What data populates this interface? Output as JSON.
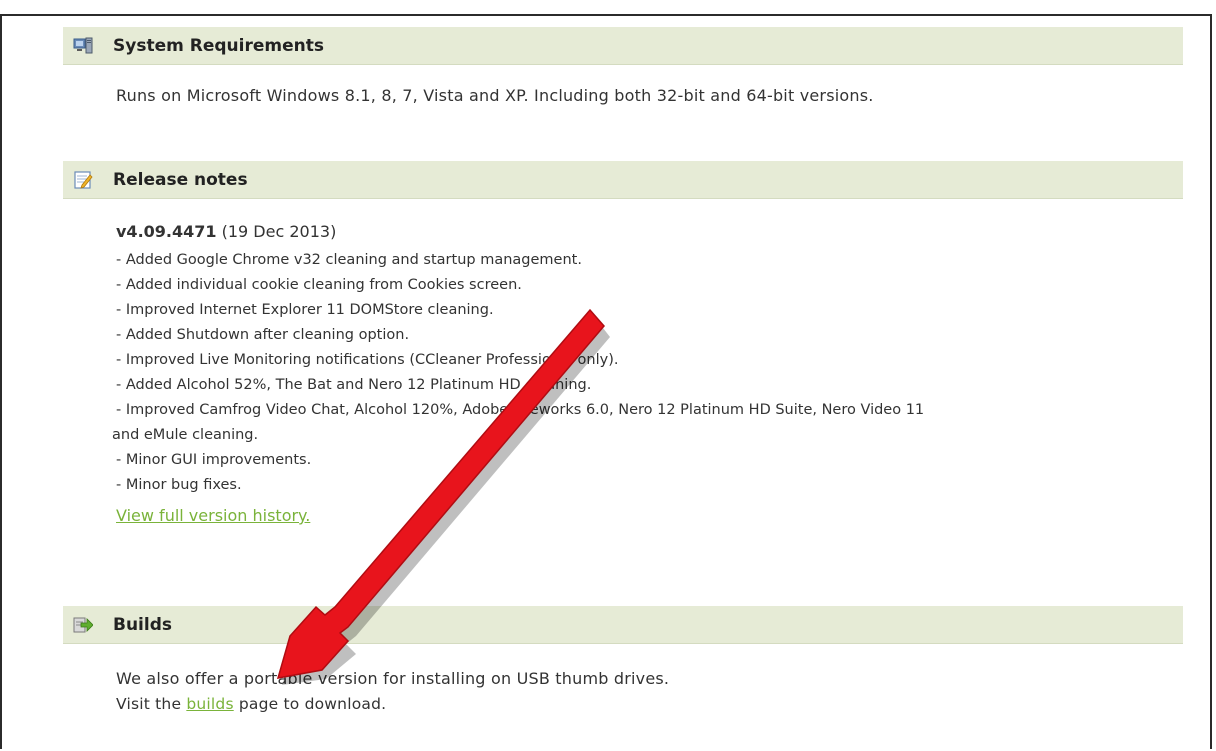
{
  "sections": {
    "system_requirements": {
      "title": "System Requirements",
      "icon": "monitor-icon",
      "text": "Runs on Microsoft Windows 8.1, 8, 7, Vista and XP. Including both 32-bit and 64-bit versions."
    },
    "release_notes": {
      "title": "Release notes",
      "icon": "notepad-icon",
      "version": "v4.09.4471",
      "date": "(19 Dec 2013)",
      "items": [
        "- Added Google Chrome v32 cleaning and startup management.",
        "- Added individual cookie cleaning from Cookies screen.",
        "- Improved Internet Explorer 11 DOMStore cleaning.",
        "- Added Shutdown after cleaning option.",
        "- Improved Live Monitoring notifications (CCleaner Professional only).",
        "- Added Alcohol 52%, The Bat and Nero 12 Platinum HD cleaning.",
        "- Improved Camfrog Video Chat, Alcohol 120%, Adobe Fireworks 6.0, Nero 12 Platinum HD Suite, Nero Video 11",
        "and eMule cleaning.",
        "- Minor GUI improvements.",
        "- Minor bug fixes."
      ],
      "history_link": "View full version history."
    },
    "builds": {
      "title": "Builds",
      "icon": "builds-arrow-icon",
      "line1": "We also offer a portable version for installing on USB thumb drives.",
      "line2_prefix": "Visit the ",
      "line2_link": "builds",
      "line2_suffix": " page to download."
    }
  },
  "colors": {
    "header_bg": "#e6ebd6",
    "link": "#7ab33a",
    "annotation_arrow": "#e8141c"
  }
}
